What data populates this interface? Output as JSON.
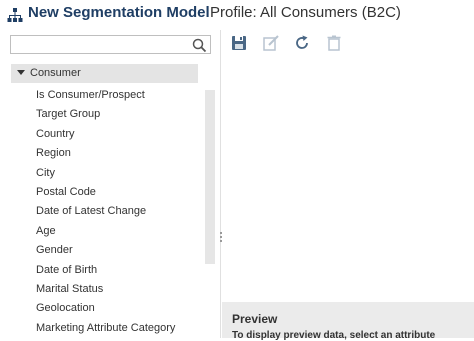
{
  "header": {
    "app_icon": "hierarchy-icon",
    "title": "New Segmentation Model",
    "profile": "Profile: All Consumers (B2C)"
  },
  "search": {
    "value": "",
    "placeholder": "",
    "icon": "search-icon"
  },
  "tree": {
    "root_label": "Consumer",
    "root_expanded": true,
    "items": [
      {
        "label": "Is Consumer/Prospect"
      },
      {
        "label": "Target Group"
      },
      {
        "label": "Country"
      },
      {
        "label": "Region"
      },
      {
        "label": "City"
      },
      {
        "label": "Postal Code"
      },
      {
        "label": "Date of Latest Change"
      },
      {
        "label": "Age"
      },
      {
        "label": "Gender"
      },
      {
        "label": "Date of Birth"
      },
      {
        "label": "Marital Status"
      },
      {
        "label": "Geolocation"
      },
      {
        "label": "Marketing Attribute Category"
      }
    ]
  },
  "toolbar": {
    "buttons": [
      "save-icon",
      "edit-icon",
      "refresh-icon",
      "delete-icon"
    ]
  },
  "preview": {
    "title": "Preview",
    "text": "To display preview data, select an attribute"
  },
  "colors": {
    "title": "#1f3e64",
    "tree_root_bg": "#e4e4e4",
    "preview_bg": "#ebebeb",
    "icon_active": "#4a6785",
    "icon_disabled": "#b8c4d0"
  }
}
